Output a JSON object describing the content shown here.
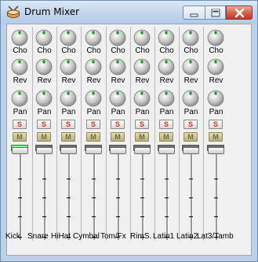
{
  "window": {
    "title": "Drum Mixer"
  },
  "titlebar_buttons": [
    "minimize",
    "maximize",
    "close"
  ],
  "knob_labels": {
    "chorus": "Cho",
    "reverb": "Rev",
    "pan": "Pan"
  },
  "button_labels": {
    "solo": "S",
    "mute": "M"
  },
  "channels": [
    {
      "name": "Kick",
      "meter_active": true
    },
    {
      "name": "Snare",
      "meter_active": false
    },
    {
      "name": "HiHat",
      "meter_active": false
    },
    {
      "name": "Cymbal",
      "meter_active": false
    },
    {
      "name": "Tom/Fx",
      "meter_active": false
    },
    {
      "name": "RimS.",
      "meter_active": false
    },
    {
      "name": "Latin1",
      "meter_active": false
    },
    {
      "name": "Latin2",
      "meter_active": false
    },
    {
      "name": "Lat3/Tamb",
      "meter_active": false
    }
  ],
  "colors": {
    "solo_text": "#c0392b",
    "mute_face": "#c9c08a",
    "meter_on": "#15c615",
    "knob_marker": "#2e8b2e"
  }
}
